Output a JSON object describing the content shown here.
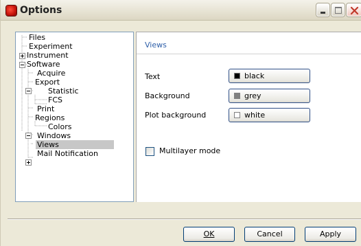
{
  "window": {
    "title": "Options"
  },
  "tree": {
    "items": [
      {
        "label": "Files",
        "expander": null,
        "selected": false
      },
      {
        "label": "Experiment",
        "expander": null,
        "selected": false
      },
      {
        "label": "Instrument",
        "expander": "plus",
        "selected": false
      },
      {
        "label": "Software",
        "expander": "minus",
        "selected": false
      },
      {
        "label": "Acquire",
        "expander": null,
        "selected": false
      },
      {
        "label": "Export",
        "expander": "minus",
        "selected": false
      },
      {
        "label": "Statistic",
        "expander": null,
        "selected": false
      },
      {
        "label": "FCS",
        "expander": null,
        "selected": false
      },
      {
        "label": "Print",
        "expander": null,
        "selected": false
      },
      {
        "label": "Regions",
        "expander": "minus",
        "selected": false
      },
      {
        "label": "Colors",
        "expander": null,
        "selected": false
      },
      {
        "label": "Windows",
        "expander": null,
        "selected": false
      },
      {
        "label": "Views",
        "expander": "plus",
        "selected": true
      },
      {
        "label": "Mail Notification",
        "expander": null,
        "selected": false
      }
    ]
  },
  "panel": {
    "title": "Views",
    "settings": [
      {
        "label": "Text",
        "value": "black",
        "swatch": "#000000"
      },
      {
        "label": "Background",
        "value": "grey",
        "swatch": "#808080"
      },
      {
        "label": "Plot background",
        "value": "white",
        "swatch": "#ffffff"
      }
    ],
    "multilayer": {
      "label": "Multilayer mode",
      "checked": false
    }
  },
  "buttons": {
    "ok": "OK",
    "cancel": "Cancel",
    "apply": "Apply"
  },
  "colors": {
    "panel_title": "#2d5ea8",
    "selection": "#c7c7c7",
    "button_border": "#003c74"
  }
}
